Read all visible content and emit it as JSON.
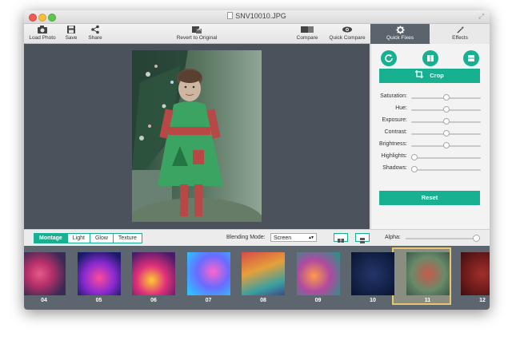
{
  "window": {
    "title": "SNV10010.JPG"
  },
  "toolbar": {
    "load_photo": "Load Photo",
    "save": "Save",
    "share": "Share",
    "revert": "Revert to Original",
    "compare": "Compare",
    "quick_compare": "Quick Compare"
  },
  "tabs": {
    "quick_fixes": "Quick Fixes",
    "effects": "Effects"
  },
  "panel": {
    "crop_label": "Crop",
    "reset_label": "Reset",
    "sliders": [
      {
        "label": "Saturation:",
        "value": 0.5
      },
      {
        "label": "Hue:",
        "value": 0.5
      },
      {
        "label": "Exposure:",
        "value": 0.5
      },
      {
        "label": "Contrast:",
        "value": 0.5
      },
      {
        "label": "Brightness:",
        "value": 0.5
      },
      {
        "label": "Highlights:",
        "value": 0.0
      },
      {
        "label": "Shadows:",
        "value": 0.0
      }
    ]
  },
  "bottom": {
    "modes": [
      "Montage",
      "Light",
      "Glow",
      "Texture"
    ],
    "active_mode": "Montage",
    "blending_label": "Blending Mode:",
    "blending_value": "Screen",
    "alpha_label": "Alpha:",
    "alpha_value": 1.0
  },
  "filmstrip": {
    "items": [
      {
        "label": "04"
      },
      {
        "label": "05"
      },
      {
        "label": "06"
      },
      {
        "label": "07"
      },
      {
        "label": "08"
      },
      {
        "label": "09"
      },
      {
        "label": "10"
      },
      {
        "label": "11",
        "selected": true
      },
      {
        "label": "12"
      }
    ]
  },
  "colors": {
    "accent": "#17b091",
    "canvas_bg": "#4b525b",
    "filmstrip_bg": "#5d666f",
    "selected_frame": "#e9c56b"
  }
}
